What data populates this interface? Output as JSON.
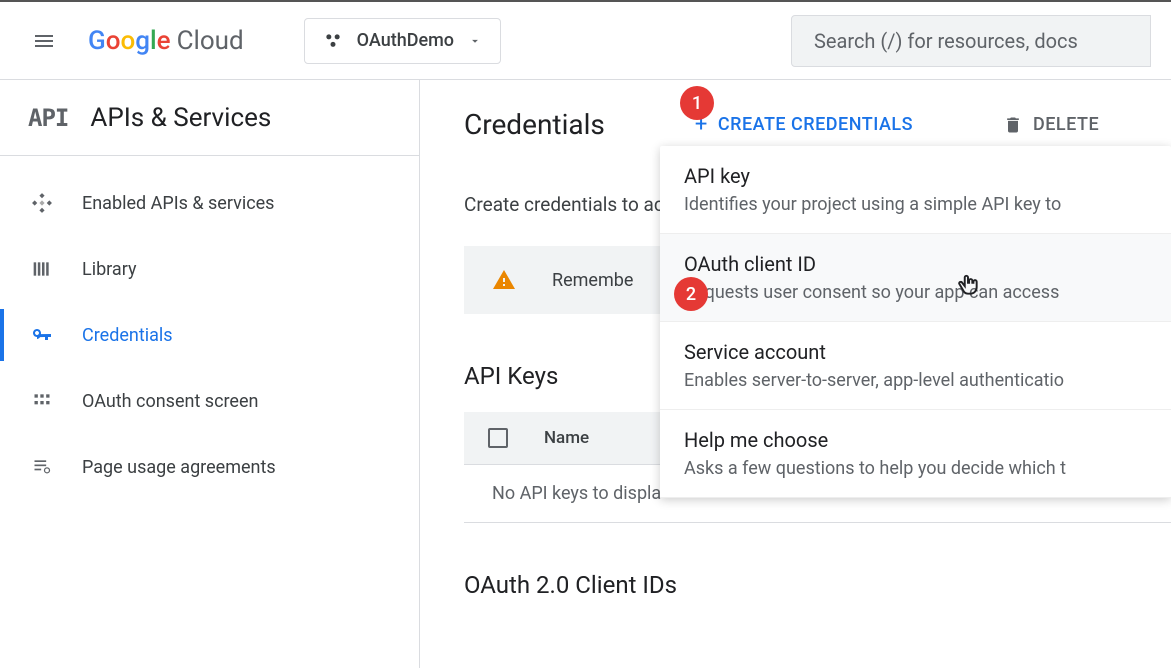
{
  "header": {
    "logo_text_cloud": "Cloud",
    "project_name": "OAuthDemo",
    "search_placeholder": "Search (/) for resources, docs"
  },
  "sidebar": {
    "title": "APIs & Services",
    "api_icon_text": "API",
    "items": [
      {
        "label": "Enabled APIs & services"
      },
      {
        "label": "Library"
      },
      {
        "label": "Credentials"
      },
      {
        "label": "OAuth consent screen"
      },
      {
        "label": "Page usage agreements"
      }
    ]
  },
  "main": {
    "title": "Credentials",
    "create_btn": "CREATE CREDENTIALS",
    "delete_btn": "DELETE",
    "body_text": "Create credentials to ac",
    "warning_text": "Remembe",
    "section_api_keys": "API Keys",
    "table_col_name": "Name",
    "table_empty": "No API keys to displa",
    "section_oauth": "OAuth 2.0 Client IDs"
  },
  "dropdown": {
    "items": [
      {
        "title": "API key",
        "desc": "Identifies your project using a simple API key to"
      },
      {
        "title": "OAuth client ID",
        "desc": "Requests user consent so your app can access "
      },
      {
        "title": "Service account",
        "desc": "Enables server-to-server, app-level authenticatio"
      },
      {
        "title": "Help me choose",
        "desc": "Asks a few questions to help you decide which t"
      }
    ]
  },
  "badges": {
    "one": "1",
    "two": "2"
  }
}
